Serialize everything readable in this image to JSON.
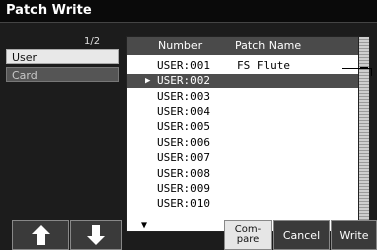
{
  "window": {
    "title": "Patch Write"
  },
  "destinations": {
    "page_indicator": "1/2",
    "items": [
      {
        "label": "User",
        "selected": true
      },
      {
        "label": "Card",
        "selected": false
      }
    ]
  },
  "list": {
    "columns": {
      "number": "Number",
      "patch_name": "Patch Name"
    },
    "rows": [
      {
        "number": "USER:001",
        "name": "FS Flute"
      },
      {
        "number": "USER:002",
        "name": "",
        "selected": true
      },
      {
        "number": "USER:003",
        "name": ""
      },
      {
        "number": "USER:004",
        "name": ""
      },
      {
        "number": "USER:005",
        "name": ""
      },
      {
        "number": "USER:006",
        "name": ""
      },
      {
        "number": "USER:007",
        "name": ""
      },
      {
        "number": "USER:008",
        "name": ""
      },
      {
        "number": "USER:009",
        "name": ""
      },
      {
        "number": "USER:010",
        "name": ""
      }
    ]
  },
  "buttons": {
    "up": "up-arrow-icon",
    "down": "down-arrow-icon",
    "compare_line1": "Com-",
    "compare_line2": "pare",
    "cancel": "Cancel",
    "write": "Write"
  },
  "colors": {
    "background": "#1c1c1c",
    "list_bg": "#ffffff",
    "selection": "#4d4d4d"
  }
}
